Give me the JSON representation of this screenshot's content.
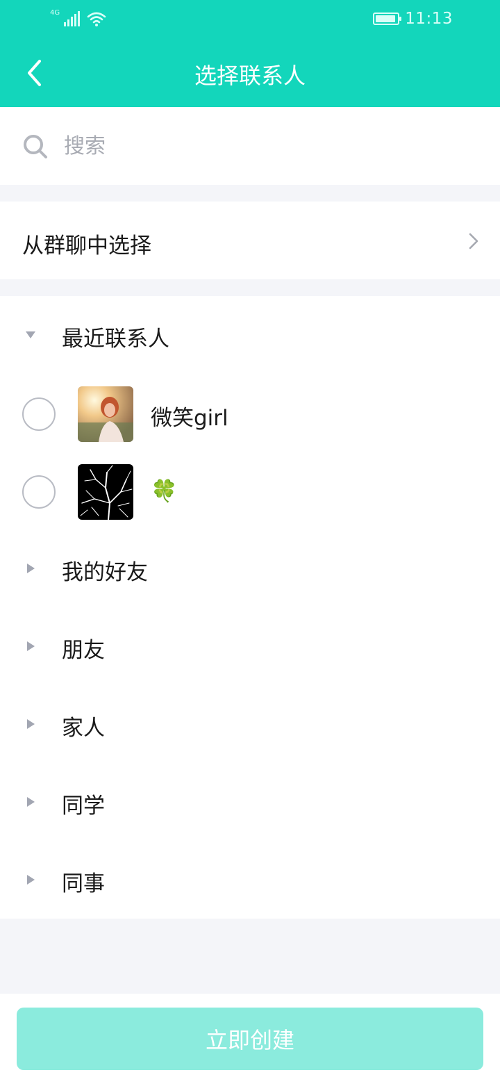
{
  "status_bar": {
    "network": "4G",
    "time": "11:13",
    "signal_icon": "signal-bars-icon",
    "wifi_icon": "wifi-icon",
    "battery_icon": "battery-icon"
  },
  "header": {
    "title": "选择联系人",
    "back_icon": "chevron-left-icon",
    "background": "#13D6BB"
  },
  "search": {
    "placeholder": "搜索",
    "value": "",
    "icon": "search-icon"
  },
  "group_select": {
    "label": "从群聊中选择",
    "icon": "chevron-right-icon"
  },
  "groups": [
    {
      "label": "最近联系人",
      "expanded": true,
      "contacts": [
        {
          "name": "微笑girl",
          "selected": false,
          "avatar": "photo-avatar"
        },
        {
          "name": "🍀",
          "selected": false,
          "avatar": "tree-branches-avatar"
        }
      ]
    },
    {
      "label": "我的好友",
      "expanded": false
    },
    {
      "label": "朋友",
      "expanded": false
    },
    {
      "label": "家人",
      "expanded": false
    },
    {
      "label": "同学",
      "expanded": false
    },
    {
      "label": "同事",
      "expanded": false
    }
  ],
  "footer": {
    "create_label": "立即创建",
    "button_color": "#8BEBDD"
  }
}
